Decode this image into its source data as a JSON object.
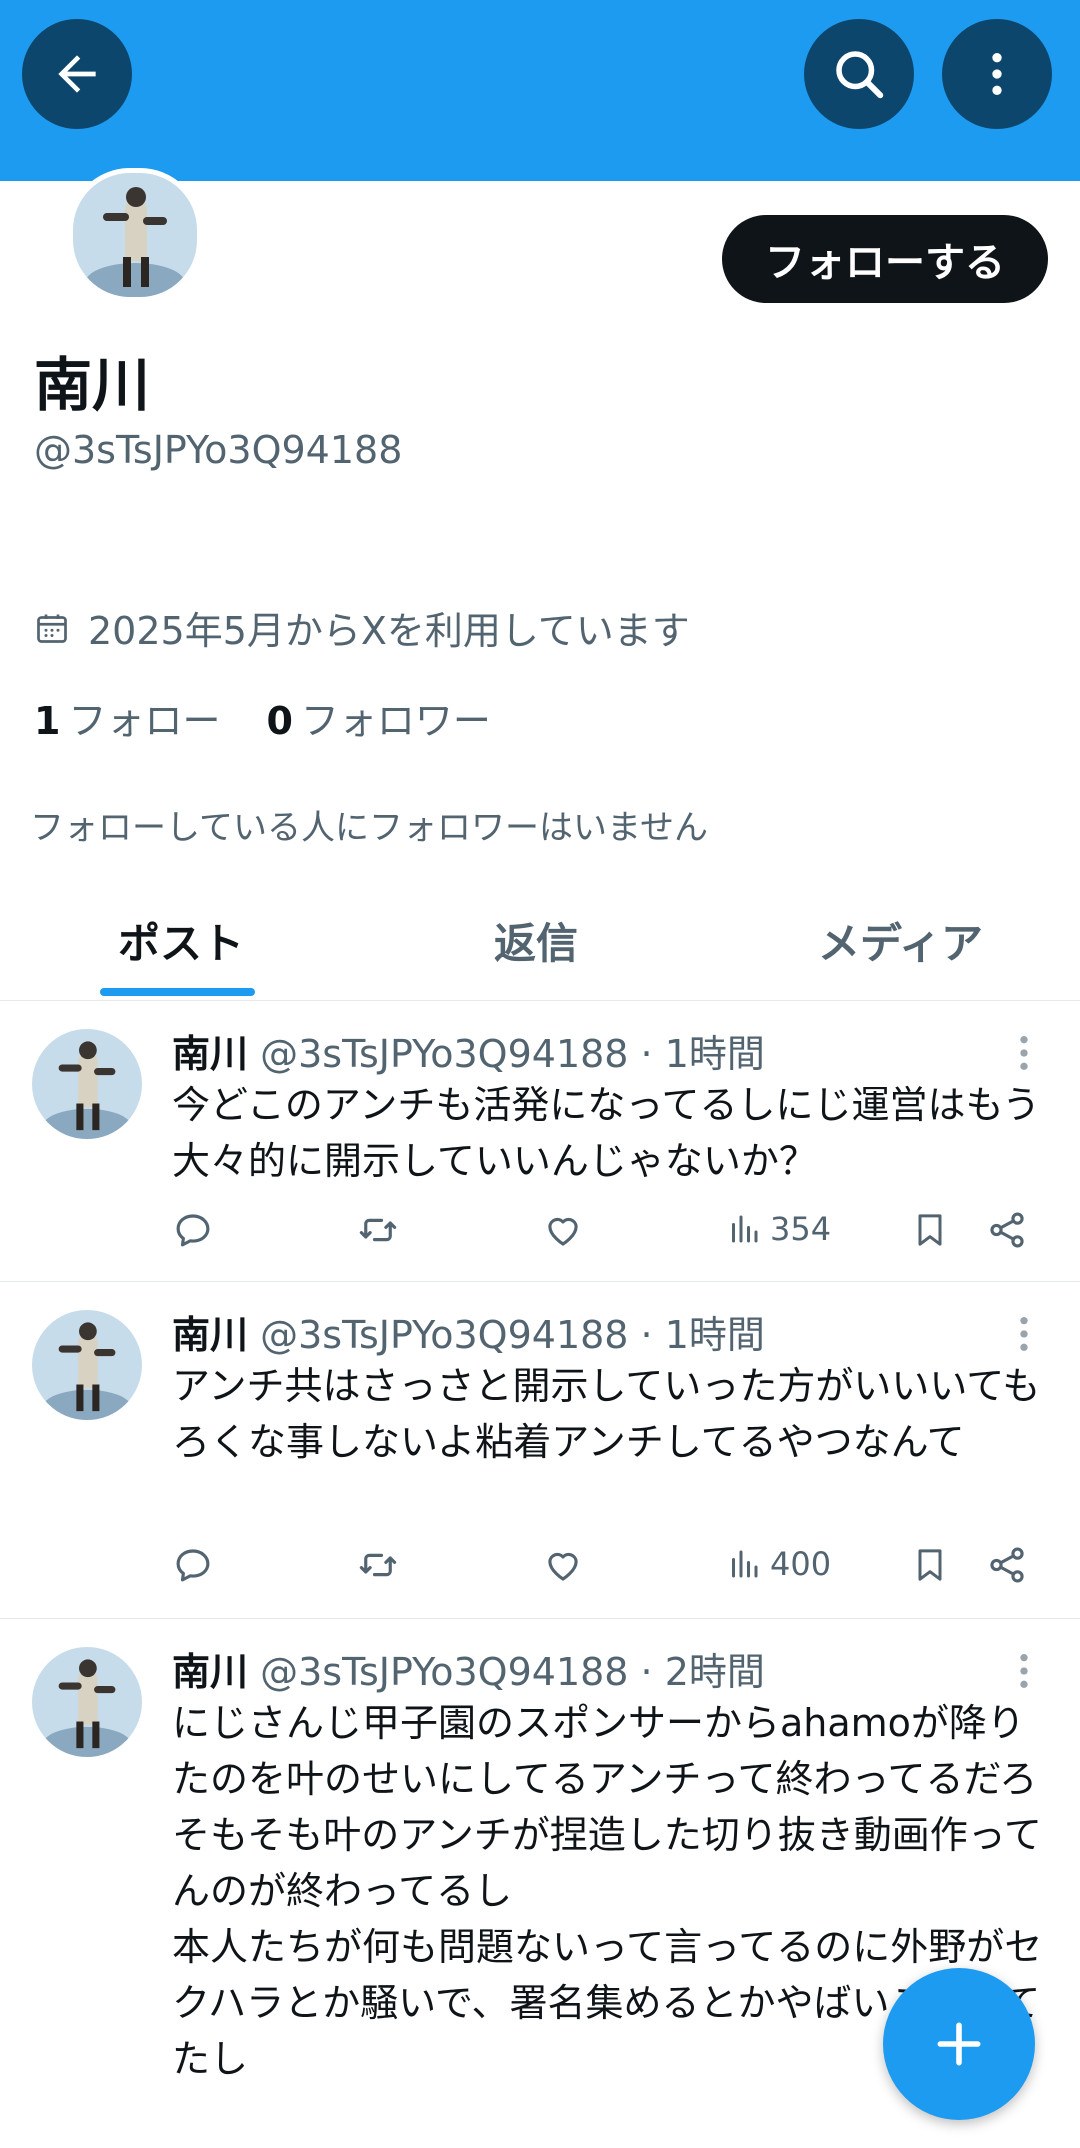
{
  "colors": {
    "accent": "#1d9bf0",
    "text": "#0f1419",
    "secondary": "#536471"
  },
  "header": {
    "back_icon": "arrow-left-icon",
    "search_icon": "search-icon",
    "more_icon": "more-vertical-icon"
  },
  "profile": {
    "name": "南川",
    "handle": "@3sTsJPYo3Q94188",
    "follow_label": "フォローする",
    "joined": "2025年5月からXを利用しています",
    "following_count": "1",
    "following_label": "フォロー",
    "followers_count": "0",
    "followers_label": "フォロワー",
    "no_followers_note": "フォローしている人にフォロワーはいません"
  },
  "tabs": [
    {
      "label": "ポスト",
      "active": true
    },
    {
      "label": "返信",
      "active": false
    },
    {
      "label": "メディア",
      "active": false
    }
  ],
  "posts": [
    {
      "name": "南川",
      "meta": "@3sTsJPYo3Q94188 · 1時間",
      "text": "今どこのアンチも活発になってるしにじ運営はもう大々的に開示していいんじゃないか？",
      "views": "354"
    },
    {
      "name": "南川",
      "meta": "@3sTsJPYo3Q94188 · 1時間",
      "text": "アンチ共はさっさと開示していった方がいいいてもろくな事しないよ粘着アンチしてるやつなんて",
      "views": "400"
    },
    {
      "name": "南川",
      "meta": "@3sTsJPYo3Q94188 · 2時間",
      "text": "にじさんじ甲子園のスポンサーからahamoが降りたのを叶のせいにしてるアンチって終わってるだろ\nそもそも叶のアンチが捏造した切り抜き動画作ってんのが終わってるし\n本人たちが何も問題ないって言ってるのに外野がセクハラとか騒いで、署名集めるとかやばいことしてたし"
    }
  ],
  "fab": {
    "icon": "plus-icon"
  }
}
